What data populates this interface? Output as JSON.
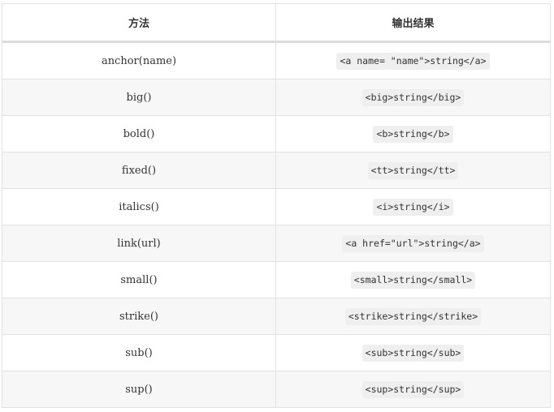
{
  "table": {
    "headers": [
      "方法",
      "输出结果"
    ],
    "rows": [
      {
        "method": "anchor(name)",
        "output": "<a name= \"name\">string</a>"
      },
      {
        "method": "big()",
        "output": "<big>string</big>"
      },
      {
        "method": "bold()",
        "output": "<b>string</b>"
      },
      {
        "method": "fixed()",
        "output": "<tt>string</tt>"
      },
      {
        "method": "italics()",
        "output": "<i>string</i>"
      },
      {
        "method": "link(url)",
        "output": "<a href=\"url\">string</a>"
      },
      {
        "method": "small()",
        "output": "<small>string</small>"
      },
      {
        "method": "strike()",
        "output": "<strike>string</strike>"
      },
      {
        "method": "sub()",
        "output": "<sub>string</sub>"
      },
      {
        "method": "sup()",
        "output": "<sup>string</sup>"
      }
    ]
  },
  "colors": {
    "border": "#e2e2e2",
    "stripe": "#f7f7f7",
    "code_background": "#efefef",
    "text": "#333333"
  }
}
